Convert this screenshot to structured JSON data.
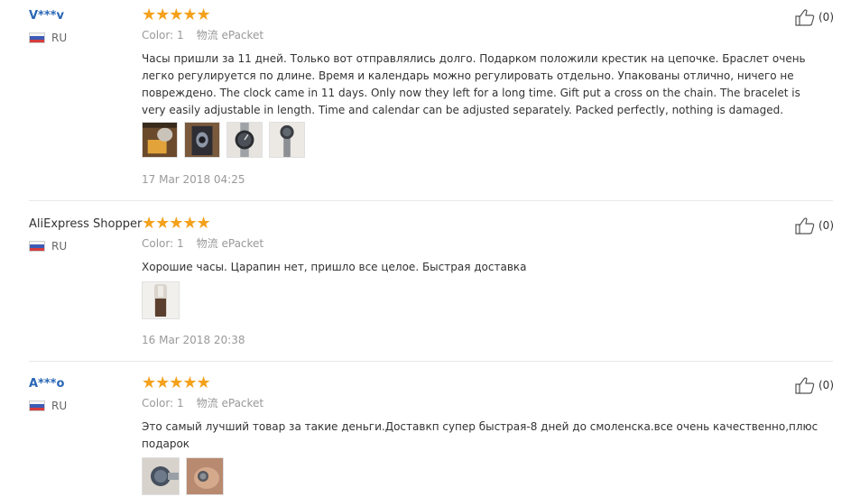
{
  "reviews": [
    {
      "user": "V***v",
      "country": "RU",
      "stars": "★★★★★",
      "color_label": "Color:",
      "color_value": "1",
      "logistics_label": "物流",
      "logistics_value": "ePacket",
      "text": "Часы пришли за 11 дней. Только вот отправлялись долго. Подарком положили крестик на цепочке. Браслет очень легко регулируется по длине. Время и календарь можно регулировать отдельно. Упакованы отлично, ничего не повреждено. The clock came in 11 days. Only now they left for a long time. Gift put a cross on the chain. The bracelet is very easily adjustable in length. Time and calendar can be adjusted separately. Packed perfectly, nothing is damaged.",
      "date": "17 Mar 2018 04:25",
      "useful_count": "(0)",
      "photos": [
        "photo-box-orange",
        "photo-box-dark",
        "photo-watch-face",
        "photo-watch-side"
      ]
    },
    {
      "user": "AliExpress Shopper",
      "country": "RU",
      "stars": "★★★★★",
      "color_label": "Color:",
      "color_value": "1",
      "logistics_label": "物流",
      "logistics_value": "ePacket",
      "text": "Хорошие часы. Царапин нет, пришло все целое. Быстрая доставка",
      "date": "16 Mar 2018 20:38",
      "useful_count": "(0)",
      "photos": [
        "photo-watch-hand"
      ]
    },
    {
      "user": "A***o",
      "country": "RU",
      "stars": "★★★★★",
      "color_label": "Color:",
      "color_value": "1",
      "logistics_label": "物流",
      "logistics_value": "ePacket",
      "text": "Это самый лучший товар за такие деньги.Доставкп супер быстрая-8 дней до смоленска.все очень качественно,плюс подарок",
      "date": "",
      "useful_count": "(0)",
      "photos": [
        "photo-watch-blue",
        "photo-watch-palm"
      ]
    }
  ],
  "colors": {
    "star": "#f4a11b",
    "link": "#2a66b5",
    "muted": "#999999"
  }
}
